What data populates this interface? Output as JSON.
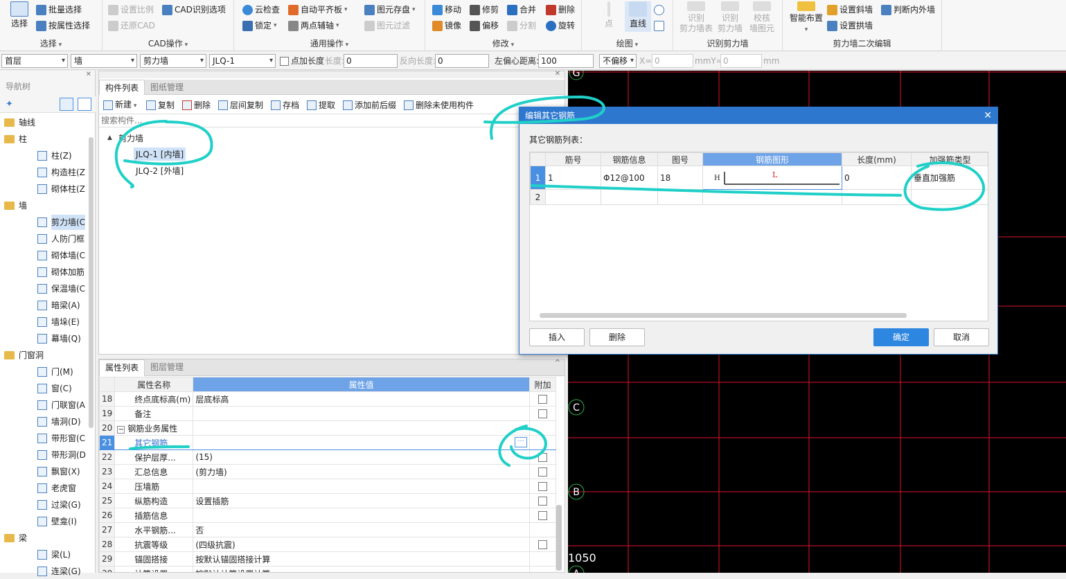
{
  "ribbon": {
    "select_big": "选择",
    "select_group": {
      "batch_select": "批量选择",
      "select_by_attr": "按属性选择",
      "label": "选择"
    },
    "cad_group": {
      "set_ratio": "设置比例",
      "restore_cad": "还原CAD",
      "cad_options": "CAD识别选项",
      "label": "CAD操作"
    },
    "general_group": {
      "cloud_check": "云检查",
      "lock": "锁定",
      "auto_floor": "自动平齐板",
      "two_point_axis": "两点辅轴",
      "save_element": "图元存盘",
      "element_filter": "图元过滤",
      "label": "通用操作"
    },
    "modify_group": {
      "move": "移动",
      "trim": "修剪",
      "merge": "合并",
      "delete": "删除",
      "mirror": "镜像",
      "offset": "偏移",
      "split": "分割",
      "rotate": "旋转",
      "label": "修改"
    },
    "draw_group": {
      "point": "点",
      "line": "直线",
      "label": "绘图"
    },
    "recognize_group": {
      "r1a": "识别",
      "r1b": "剪力墙表",
      "r2a": "识别",
      "r2b": "剪力墙",
      "r3a": "校核",
      "r3b": "墙图元",
      "label": "识别剪力墙"
    },
    "edit_group": {
      "smart_layout": "智能布置",
      "set_slope": "设置斜墙",
      "judge_inout": "判断内外墙",
      "set_arch": "设置拱墙",
      "label": "剪力墙二次编辑"
    }
  },
  "toolbar2": {
    "floor": "首层",
    "type": "墙",
    "subtype": "剪力墙",
    "element": "JLQ-1",
    "add_length_label": "点加长度",
    "length_label": "长度:",
    "length_value": "0",
    "reverse_label": "反向长度:",
    "reverse_value": "0",
    "offset_label": "左偏心距离:",
    "offset_value": "100",
    "no_offset": "不偏移",
    "x_label": "X=",
    "x_value": "0",
    "y_label": "mmY=",
    "y_value": "0",
    "unit": "mm"
  },
  "nav": {
    "title": "导航树",
    "items": [
      {
        "label": "轴线",
        "kind": "folder"
      },
      {
        "label": "柱",
        "kind": "folder"
      },
      {
        "label": "柱(Z)",
        "kind": "item"
      },
      {
        "label": "构造柱(Z",
        "kind": "item"
      },
      {
        "label": "砌体柱(Z",
        "kind": "item"
      },
      {
        "label": "墙",
        "kind": "folder"
      },
      {
        "label": "剪力墙(C",
        "kind": "item",
        "selected": true
      },
      {
        "label": "人防门框",
        "kind": "item"
      },
      {
        "label": "砌体墙(C",
        "kind": "item"
      },
      {
        "label": "砌体加筋",
        "kind": "item"
      },
      {
        "label": "保温墙(C",
        "kind": "item"
      },
      {
        "label": "暗梁(A)",
        "kind": "item"
      },
      {
        "label": "墙垛(E)",
        "kind": "item"
      },
      {
        "label": "幕墙(Q)",
        "kind": "item"
      },
      {
        "label": "门窗洞",
        "kind": "folder"
      },
      {
        "label": "门(M)",
        "kind": "item"
      },
      {
        "label": "窗(C)",
        "kind": "item"
      },
      {
        "label": "门联窗(A",
        "kind": "item"
      },
      {
        "label": "墙洞(D)",
        "kind": "item"
      },
      {
        "label": "带形窗(C",
        "kind": "item"
      },
      {
        "label": "带形洞(D",
        "kind": "item"
      },
      {
        "label": "飘窗(X)",
        "kind": "item"
      },
      {
        "label": "老虎窗",
        "kind": "item"
      },
      {
        "label": "过梁(G)",
        "kind": "item"
      },
      {
        "label": "壁龛(I)",
        "kind": "item"
      },
      {
        "label": "梁",
        "kind": "folder"
      },
      {
        "label": "梁(L)",
        "kind": "item"
      },
      {
        "label": "连梁(G)",
        "kind": "item"
      }
    ]
  },
  "component": {
    "tabs": [
      "构件列表",
      "图纸管理"
    ],
    "tools": {
      "new": "新建",
      "copy": "复制",
      "delete": "删除",
      "floor_copy": "层间复制",
      "save": "存档",
      "extract": "提取",
      "prefix": "添加前后缀",
      "del_unused": "删除未使用构件"
    },
    "search_placeholder": "搜索构件...",
    "tree_root": "剪力墙",
    "tree_items": [
      "JLQ-1 [内墙]",
      "JLQ-2 [外墙]"
    ]
  },
  "props": {
    "tabs": [
      "属性列表",
      "图层管理"
    ],
    "headers": [
      "属性名称",
      "属性值",
      "附加"
    ],
    "rows": [
      {
        "n": "18",
        "name": "终点底标高(m)",
        "value": "层底标高",
        "cb": true
      },
      {
        "n": "19",
        "name": "备注",
        "value": "",
        "cb": true
      },
      {
        "n": "20",
        "name": "钢筋业务属性",
        "value": "",
        "cb": false,
        "group": true
      },
      {
        "n": "21",
        "name": "其它钢筋",
        "value": "",
        "cb": false,
        "hl": true
      },
      {
        "n": "22",
        "name": "保护层厚...",
        "value": "(15)",
        "cb": true
      },
      {
        "n": "23",
        "name": "汇总信息",
        "value": "(剪力墙)",
        "cb": true
      },
      {
        "n": "24",
        "name": "压墙筋",
        "value": "",
        "cb": true
      },
      {
        "n": "25",
        "name": "纵筋构造",
        "value": "设置插筋",
        "cb": true
      },
      {
        "n": "26",
        "name": "插筋信息",
        "value": "",
        "cb": true
      },
      {
        "n": "27",
        "name": "水平钢筋...",
        "value": "否",
        "cb": false
      },
      {
        "n": "28",
        "name": "抗震等级",
        "value": "(四级抗震)",
        "cb": true
      },
      {
        "n": "29",
        "name": "锚固搭接",
        "value": "按默认锚固搭接计算",
        "cb": false
      },
      {
        "n": "30",
        "name": "计算设置",
        "value": "按默认计算设置计算",
        "cb": false
      }
    ]
  },
  "dialog": {
    "title": "编辑其它钢筋",
    "list_label": "其它钢筋列表：",
    "headers": [
      "筋号",
      "钢筋信息",
      "图号",
      "钢筋图形",
      "长度(mm)",
      "加强筋类型"
    ],
    "rows": [
      {
        "n": "1",
        "bar_no": "1",
        "info": "Φ12@100",
        "fig": "18",
        "shape_h": "H",
        "shape_l": "L",
        "length": "0",
        "type": "垂直加强筋"
      },
      {
        "n": "2",
        "bar_no": "",
        "info": "",
        "fig": "",
        "shape_h": "",
        "shape_l": "",
        "length": "",
        "type": ""
      }
    ],
    "insert": "插入",
    "delete": "删除",
    "ok": "确定",
    "cancel": "取消"
  },
  "cad": {
    "axis_labels": [
      "G",
      "C",
      "B",
      "A"
    ],
    "dimension": "1050",
    "line_color": "#e0142a",
    "axis_color": "#2db34a"
  },
  "annotation_color": "#20d0c8"
}
